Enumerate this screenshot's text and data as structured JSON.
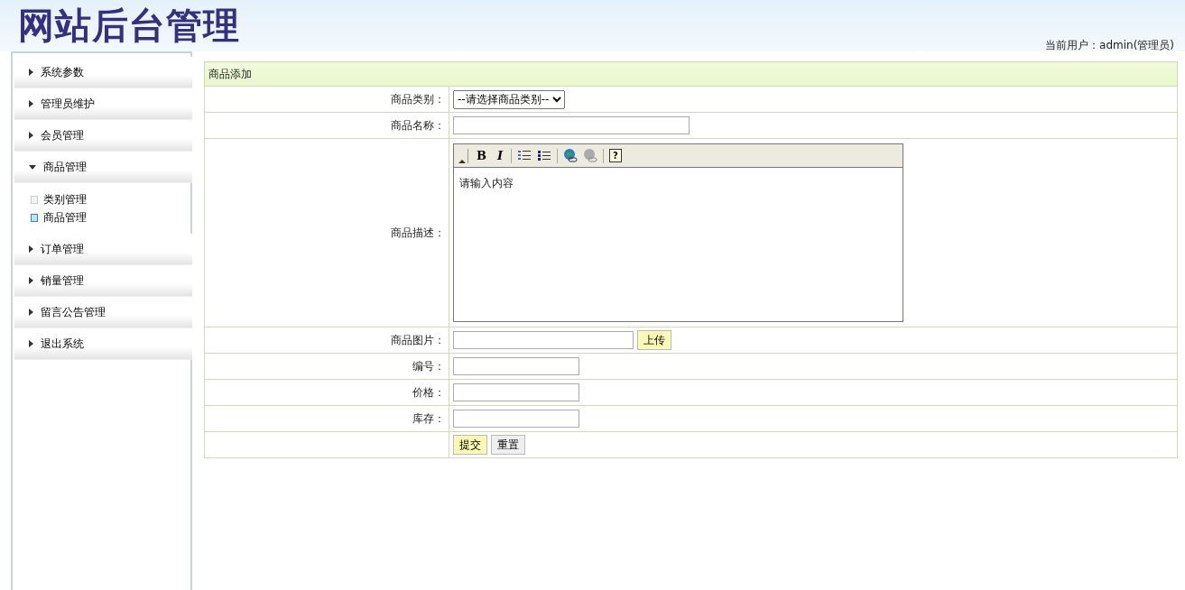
{
  "header": {
    "title": "网站后台管理",
    "current_user": "当前用户：admin(管理员)"
  },
  "sidebar": {
    "items": [
      {
        "label": "系统参数",
        "expanded": false
      },
      {
        "label": "管理员维护",
        "expanded": false
      },
      {
        "label": "会员管理",
        "expanded": false
      },
      {
        "label": "商品管理",
        "expanded": true,
        "children": [
          {
            "label": "类别管理",
            "selected": false
          },
          {
            "label": "商品管理",
            "selected": true
          }
        ]
      },
      {
        "label": "订单管理",
        "expanded": false
      },
      {
        "label": "销量管理",
        "expanded": false
      },
      {
        "label": "留言公告管理",
        "expanded": false
      },
      {
        "label": "退出系统",
        "expanded": false
      }
    ]
  },
  "form": {
    "title": "商品添加",
    "rows": [
      {
        "kind": "select",
        "label": "商品类别：",
        "value": "--请选择商品类别--"
      },
      {
        "kind": "text",
        "label": "商品名称："
      },
      {
        "kind": "editor",
        "label": "商品描述：",
        "content": "请输入内容",
        "toolbar": [
          {
            "kind": "collapse"
          },
          {
            "kind": "bold",
            "label": "B"
          },
          {
            "kind": "italic",
            "label": "I"
          },
          {
            "kind": "numbered-list"
          },
          {
            "kind": "bullet-list"
          },
          {
            "kind": "link"
          },
          {
            "kind": "unlink"
          },
          {
            "kind": "help",
            "label": "?"
          }
        ]
      },
      {
        "kind": "upload",
        "label": "商品图片：",
        "button": "上传"
      },
      {
        "kind": "short-text",
        "label": "编号："
      },
      {
        "kind": "short-text",
        "label": "价格："
      },
      {
        "kind": "short-text",
        "label": "库存："
      },
      {
        "kind": "actions",
        "buttons": [
          {
            "label": "提交",
            "kind": "submit"
          },
          {
            "label": "重置",
            "kind": "reset"
          }
        ]
      }
    ]
  }
}
